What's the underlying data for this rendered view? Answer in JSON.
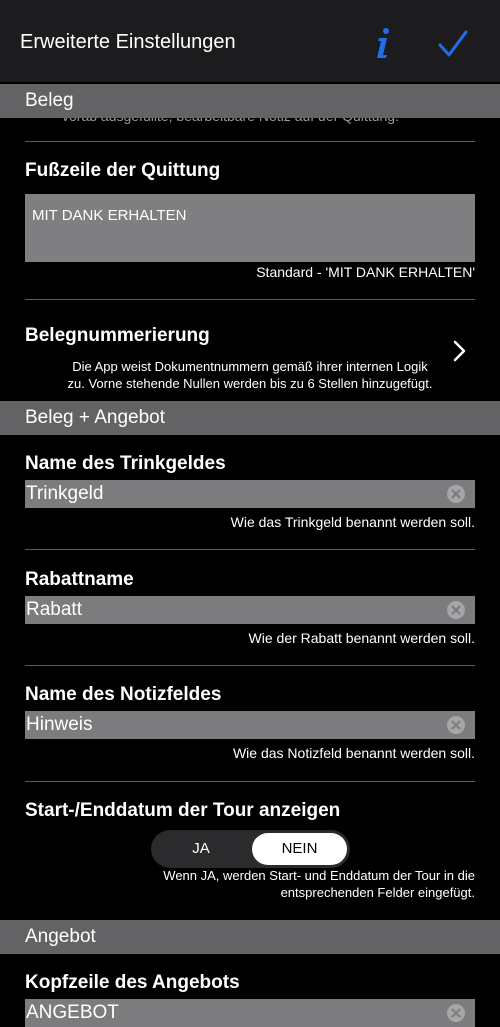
{
  "header": {
    "title": "Erweiterte Einstellungen",
    "info_icon": "info-icon",
    "confirm_icon": "checkmark-icon",
    "accent_color": "#1e6fe8"
  },
  "sections": {
    "beleg": "Beleg",
    "beleg_angebot": "Beleg + Angebot",
    "angebot": "Angebot"
  },
  "beleg": {
    "cutoff_text": "vorab ausgefüllte, bearbeitbare Notiz auf der Quittung.",
    "footer": {
      "label": "Fußzeile der Quittung",
      "value": "MIT DANK ERHALTEN",
      "hint": "Standard - 'MIT DANK ERHALTEN'"
    },
    "numbering": {
      "label": "Belegnummerierung",
      "description_line1": "Die App weist Dokumentnummern gemäß ihrer internen Logik",
      "description_line2": "zu. Vorne stehende Nullen werden bis zu 6 Stellen hinzugefügt."
    }
  },
  "beleg_angebot": {
    "tip": {
      "label": "Name des Trinkgeldes",
      "value": "Trinkgeld",
      "hint": "Wie das Trinkgeld benannt werden soll."
    },
    "discount": {
      "label": "Rabattname",
      "value": "Rabatt",
      "hint": "Wie der Rabatt benannt werden soll."
    },
    "note": {
      "label": "Name des Notizfeldes",
      "value": "Hinweis",
      "hint": "Wie das Notizfeld benannt werden soll."
    },
    "tour_dates": {
      "label": "Start-/Enddatum der Tour anzeigen",
      "option_yes": "JA",
      "option_no": "NEIN",
      "selected": "NEIN",
      "hint_line1": "Wenn JA, werden Start- und Enddatum der Tour in die",
      "hint_line2": "entsprechenden Felder eingefügt."
    }
  },
  "angebot": {
    "header_field": {
      "label": "Kopfzeile des Angebots",
      "value": "ANGEBOT"
    }
  }
}
